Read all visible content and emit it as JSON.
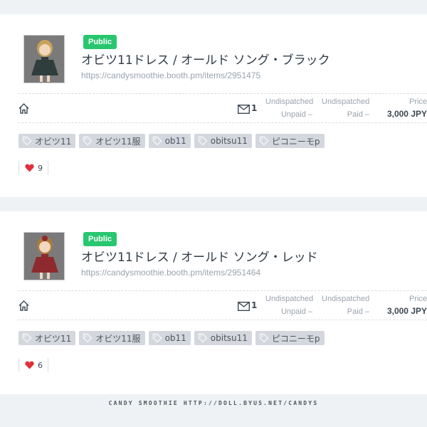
{
  "items": [
    {
      "status": "Public",
      "title": "オビツ11ドレス / オールド ソング・ブラック",
      "url": "https://candysmoothie.booth.pm/items/2951475",
      "messages": "1",
      "undispatched_unpaid_label": "Undispatched",
      "unpaid_label": "Unpaid –",
      "undispatched_paid_label": "Undispatched",
      "paid_label": "Paid –",
      "price_label": "Price",
      "price": "3,000 JPY",
      "tags": [
        "オビツ11",
        "オビツ11服",
        "ob11",
        "obitsu11",
        "ピコニーモp"
      ],
      "likes": "9",
      "dress_color": "#2f3d3c"
    },
    {
      "status": "Public",
      "title": "オビツ11ドレス / オールド ソング・レッド",
      "url": "https://candysmoothie.booth.pm/items/2951464",
      "messages": "1",
      "undispatched_unpaid_label": "Undispatched",
      "unpaid_label": "Unpaid –",
      "undispatched_paid_label": "Undispatched",
      "paid_label": "Paid –",
      "price_label": "Price",
      "price": "3,000 JPY",
      "tags": [
        "オビツ11",
        "オビツ11服",
        "ob11",
        "obitsu11",
        "ピコニーモp"
      ],
      "likes": "6",
      "dress_color": "#8e2a2e"
    }
  ],
  "footer_text": "CANDY SMOOTHIE HTTP://DOLL.BYUS.NET/CANDYS",
  "colors": {
    "public_badge": "#28c76f",
    "heart": "#e0303a",
    "tag_bg": "#d4d8de"
  }
}
